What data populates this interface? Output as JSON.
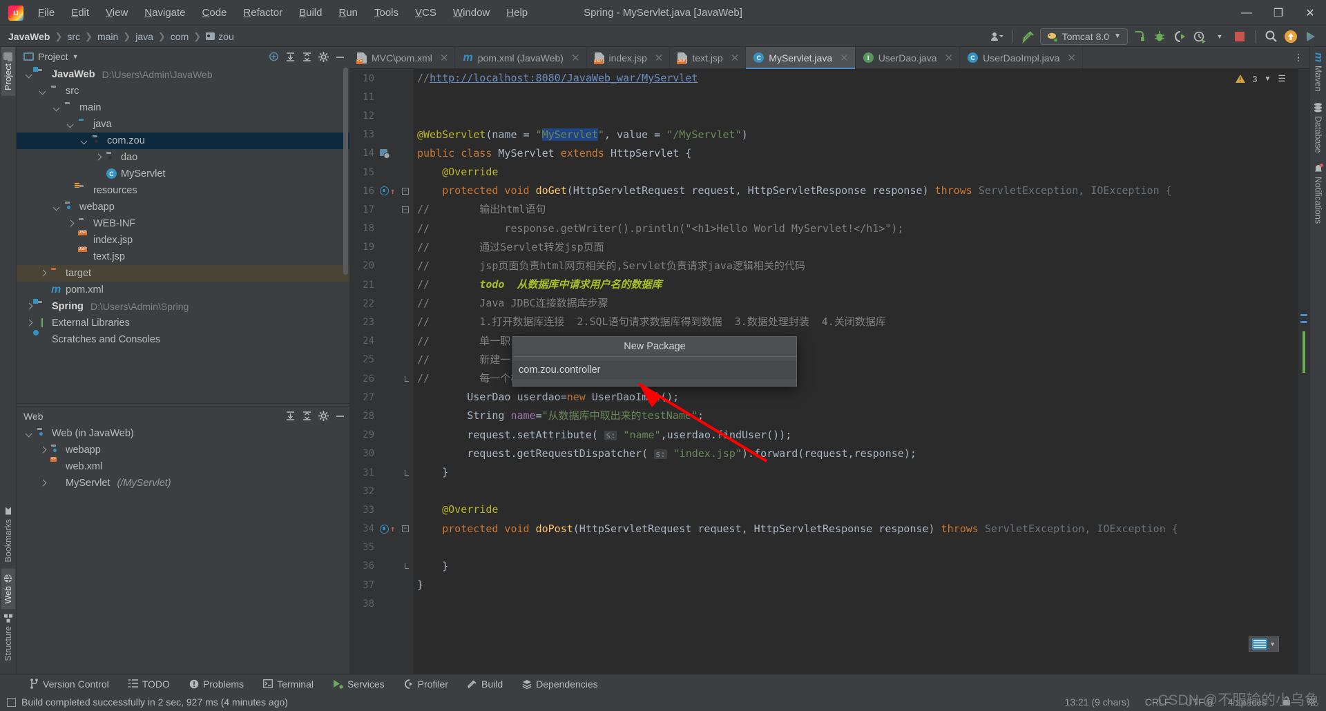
{
  "window": {
    "title": "Spring - MyServlet.java [JavaWeb]",
    "minimize": "—",
    "maximize": "❐",
    "close": "✕"
  },
  "menubar": [
    "File",
    "Edit",
    "View",
    "Navigate",
    "Code",
    "Refactor",
    "Build",
    "Run",
    "Tools",
    "VCS",
    "Window",
    "Help"
  ],
  "breadcrumb": {
    "root": "JavaWeb",
    "segments": [
      "src",
      "main",
      "java",
      "com"
    ],
    "last": "zou"
  },
  "toolbar": {
    "run_config": "Tomcat 8.0",
    "icons": [
      "settings-sync-icon",
      "build-hammer-icon",
      "run-icon",
      "debug-icon",
      "run-coverage-icon",
      "profiler-icon",
      "stop-icon",
      "search-icon",
      "updates-icon",
      "ide-features-icon"
    ]
  },
  "rails": {
    "left": [
      "Project",
      "Bookmarks",
      "Web",
      "Structure"
    ],
    "right": [
      "Maven",
      "Database",
      "Notifications"
    ]
  },
  "project_panel": {
    "title": "Project",
    "tree": [
      {
        "indent": 0,
        "arrow": "down",
        "icon": "module-folder",
        "label": "JavaWeb",
        "bold": true,
        "path": "D:\\Users\\Admin\\JavaWeb",
        "state": "normal"
      },
      {
        "indent": 1,
        "arrow": "down",
        "icon": "folder",
        "label": "src",
        "state": "normal"
      },
      {
        "indent": 2,
        "arrow": "down",
        "icon": "folder",
        "label": "main",
        "state": "normal"
      },
      {
        "indent": 3,
        "arrow": "down",
        "icon": "folder-source",
        "label": "java",
        "state": "normal"
      },
      {
        "indent": 4,
        "arrow": "down",
        "icon": "package",
        "label": "com.zou",
        "state": "selected"
      },
      {
        "indent": 5,
        "arrow": "right",
        "icon": "package",
        "label": "dao",
        "state": "normal"
      },
      {
        "indent": 5,
        "arrow": "none",
        "icon": "class",
        "label": "MyServlet",
        "state": "normal"
      },
      {
        "indent": 3,
        "arrow": "none",
        "icon": "folder-resources",
        "label": "resources",
        "state": "normal"
      },
      {
        "indent": 2,
        "arrow": "down",
        "icon": "package-web",
        "label": "webapp",
        "state": "normal"
      },
      {
        "indent": 3,
        "arrow": "right",
        "icon": "folder",
        "label": "WEB-INF",
        "state": "normal"
      },
      {
        "indent": 3,
        "arrow": "none",
        "icon": "jsp",
        "label": "index.jsp",
        "state": "normal"
      },
      {
        "indent": 3,
        "arrow": "none",
        "icon": "jsp",
        "label": "text.jsp",
        "state": "normal"
      },
      {
        "indent": 1,
        "arrow": "right",
        "icon": "folder-target",
        "label": "target",
        "state": "modified"
      },
      {
        "indent": 1,
        "arrow": "none",
        "icon": "maven",
        "label": "pom.xml",
        "state": "normal"
      },
      {
        "indent": 0,
        "arrow": "right",
        "icon": "module-folder",
        "label": "Spring",
        "bold": true,
        "path": "D:\\Users\\Admin\\Spring",
        "state": "normal"
      },
      {
        "indent": 0,
        "arrow": "right",
        "icon": "libraries",
        "label": "External Libraries",
        "state": "normal"
      },
      {
        "indent": 0,
        "arrow": "none",
        "icon": "scratches",
        "label": "Scratches and Consoles",
        "state": "normal"
      }
    ]
  },
  "web_panel": {
    "title": "Web",
    "tree": [
      {
        "indent": 0,
        "arrow": "down",
        "icon": "web-module",
        "label": "Web (in JavaWeb)"
      },
      {
        "indent": 1,
        "arrow": "right",
        "icon": "package-web",
        "label": "webapp"
      },
      {
        "indent": 1,
        "arrow": "none",
        "icon": "web-xml",
        "label": "web.xml"
      },
      {
        "indent": 1,
        "arrow": "right",
        "icon": "servlet",
        "label": "MyServlet",
        "sub": "(/MyServlet)"
      }
    ]
  },
  "tabs": [
    {
      "label": "MVC\\pom.xml",
      "icon": "xml-file-icon",
      "active": false
    },
    {
      "label": "pom.xml (JavaWeb)",
      "icon": "maven-icon",
      "active": false
    },
    {
      "label": "index.jsp",
      "icon": "jsp-file-icon",
      "active": false
    },
    {
      "label": "text.jsp",
      "icon": "jsp-file-icon",
      "active": false
    },
    {
      "label": "MyServlet.java",
      "icon": "java-class-icon",
      "active": true
    },
    {
      "label": "UserDao.java",
      "icon": "java-interface-icon",
      "active": false
    },
    {
      "label": "UserDaoImpl.java",
      "icon": "java-class-icon",
      "active": false
    }
  ],
  "inspection": {
    "warning_count": "3"
  },
  "editor": {
    "first_line": 10,
    "lines": [
      {
        "n": 10,
        "tokens": [
          {
            "t": "//",
            "c": "cmt"
          },
          {
            "t": "http://localhost:8080/JavaWeb_war/MyServlet",
            "c": "cmt-url"
          }
        ]
      },
      {
        "n": 11,
        "tokens": []
      },
      {
        "n": 12,
        "tokens": []
      },
      {
        "n": 13,
        "tokens": [
          {
            "t": "@WebServlet",
            "c": "ann"
          },
          {
            "t": "(name = ",
            "c": "id"
          },
          {
            "t": "\"",
            "c": "str"
          },
          {
            "t": "MyServlet",
            "c": "sel"
          },
          {
            "t": "\"",
            "c": "str"
          },
          {
            "t": ", value = ",
            "c": "id"
          },
          {
            "t": "\"/MyServlet\"",
            "c": "str"
          },
          {
            "t": ")",
            "c": "id"
          }
        ]
      },
      {
        "n": 14,
        "gutter": "web-bean",
        "tokens": [
          {
            "t": "public class ",
            "c": "kw"
          },
          {
            "t": "MyServlet ",
            "c": "id"
          },
          {
            "t": "extends ",
            "c": "kw"
          },
          {
            "t": "HttpServlet {",
            "c": "id"
          }
        ]
      },
      {
        "n": 15,
        "tokens": [
          {
            "t": "    @Override",
            "c": "ann"
          }
        ]
      },
      {
        "n": 16,
        "gutter": "override-up",
        "fold": "open",
        "tokens": [
          {
            "t": "    protected void ",
            "c": "kw"
          },
          {
            "t": "doGet",
            "c": "mth"
          },
          {
            "t": "(HttpServletRequest request, HttpServletResponse response) ",
            "c": "id"
          },
          {
            "t": "throws ",
            "c": "kw"
          },
          {
            "t": "ServletException, IOException {",
            "c": "gray"
          }
        ]
      },
      {
        "n": 17,
        "fold": "open",
        "tokens": [
          {
            "t": "//        输出html语句",
            "c": "cmt"
          }
        ]
      },
      {
        "n": 18,
        "tokens": [
          {
            "t": "//            response.getWriter().println(\"<h1>Hello World MyServlet!</h1>\");",
            "c": "cmt"
          }
        ]
      },
      {
        "n": 19,
        "tokens": [
          {
            "t": "//        通过Servlet转发jsp页面",
            "c": "cmt"
          }
        ]
      },
      {
        "n": 20,
        "tokens": [
          {
            "t": "//        jsp页面负责html网页相关的,Servlet负责请求java逻辑相关的代码",
            "c": "cmt"
          }
        ]
      },
      {
        "n": 21,
        "tokens": [
          {
            "t": "//        ",
            "c": "cmt"
          },
          {
            "t": "todo  从数据库中请求用户名的数据库",
            "c": "todo"
          }
        ]
      },
      {
        "n": 22,
        "tokens": [
          {
            "t": "//        Java JDBC连接数据库步骤",
            "c": "cmt"
          }
        ]
      },
      {
        "n": 23,
        "tokens": [
          {
            "t": "//        1.打开数据库连接  2.SQL语句请求数据库得到数据  3.数据处理封装  4.关闭数据库",
            "c": "cmt"
          }
        ]
      },
      {
        "n": 24,
        "tokens": [
          {
            "t": "//        单一职",
            "c": "cmt"
          }
        ]
      },
      {
        "n": 25,
        "tokens": [
          {
            "t": "//        新建一",
            "c": "cmt"
          }
        ]
      },
      {
        "n": 26,
        "fold": "close",
        "tokens": [
          {
            "t": "//        每一个模块需要一个接口+一个实现类",
            "c": "cmt"
          }
        ]
      },
      {
        "n": 27,
        "tokens": [
          {
            "t": "        UserDao userdao=",
            "c": "id"
          },
          {
            "t": "new ",
            "c": "kw"
          },
          {
            "t": "UserDaoImpl();",
            "c": "id"
          }
        ]
      },
      {
        "n": 28,
        "tokens": [
          {
            "t": "        String ",
            "c": "id"
          },
          {
            "t": "name",
            "c": "fld-c"
          },
          {
            "t": "=",
            "c": "id"
          },
          {
            "t": "\"从数据库中取出来的testName\"",
            "c": "str"
          },
          {
            "t": ";",
            "c": "id"
          }
        ]
      },
      {
        "n": 29,
        "tokens": [
          {
            "t": "        request.setAttribute( ",
            "c": "id"
          },
          {
            "t": "s:",
            "c": "hint"
          },
          {
            "t": " ",
            "c": "id"
          },
          {
            "t": "\"name\"",
            "c": "str"
          },
          {
            "t": ",userdao.findUser());",
            "c": "id"
          }
        ]
      },
      {
        "n": 30,
        "tokens": [
          {
            "t": "        request.getRequestDispatcher( ",
            "c": "id"
          },
          {
            "t": "s:",
            "c": "hint"
          },
          {
            "t": " ",
            "c": "id"
          },
          {
            "t": "\"index.jsp\"",
            "c": "str"
          },
          {
            "t": ").forward(request,response);",
            "c": "id"
          }
        ]
      },
      {
        "n": 31,
        "fold": "close",
        "tokens": [
          {
            "t": "    }",
            "c": "id"
          }
        ]
      },
      {
        "n": 32,
        "tokens": []
      },
      {
        "n": 33,
        "tokens": [
          {
            "t": "    @Override",
            "c": "ann"
          }
        ]
      },
      {
        "n": 34,
        "gutter": "override-up",
        "fold": "open",
        "tokens": [
          {
            "t": "    protected void ",
            "c": "kw"
          },
          {
            "t": "doPost",
            "c": "mth"
          },
          {
            "t": "(HttpServletRequest request, HttpServletResponse response) ",
            "c": "id"
          },
          {
            "t": "throws ",
            "c": "kw"
          },
          {
            "t": "ServletException, IOException {",
            "c": "gray"
          }
        ]
      },
      {
        "n": 35,
        "tokens": []
      },
      {
        "n": 36,
        "fold": "close",
        "tokens": [
          {
            "t": "    }",
            "c": "id"
          }
        ]
      },
      {
        "n": 37,
        "tokens": [
          {
            "t": "}",
            "c": "id"
          }
        ]
      },
      {
        "n": 38,
        "tokens": []
      }
    ]
  },
  "dialog": {
    "title": "New Package",
    "value": "com.zou.controller"
  },
  "bottom_tools": [
    {
      "label": "Version Control",
      "icon": "branch-icon"
    },
    {
      "label": "TODO",
      "icon": "list-icon"
    },
    {
      "label": "Problems",
      "icon": "error-icon"
    },
    {
      "label": "Terminal",
      "icon": "terminal-icon"
    },
    {
      "label": "Services",
      "icon": "services-icon"
    },
    {
      "label": "Profiler",
      "icon": "profiler-icon"
    },
    {
      "label": "Build",
      "icon": "hammer-icon"
    },
    {
      "label": "Dependencies",
      "icon": "layers-icon"
    }
  ],
  "statusbar": {
    "message": "Build completed successfully in 2 sec, 927 ms (4 minutes ago)",
    "position": "13:21 (9 chars)",
    "line_sep": "CRLF",
    "encoding": "UTF-8",
    "indent": "4 spaces",
    "watermark": "CSDN @不服输的小乌龟"
  },
  "colors": {
    "chrome": "#3c3f41",
    "editor_bg": "#2b2b2b",
    "gutter_bg": "#313335",
    "accent": "#3592c4",
    "selection": "#0d293e",
    "keyword": "#cc7832",
    "string": "#6a8759",
    "annotation": "#bbb529",
    "comment": "#808080",
    "todo": "#a8c023",
    "arrow_red": "#ff0000"
  }
}
